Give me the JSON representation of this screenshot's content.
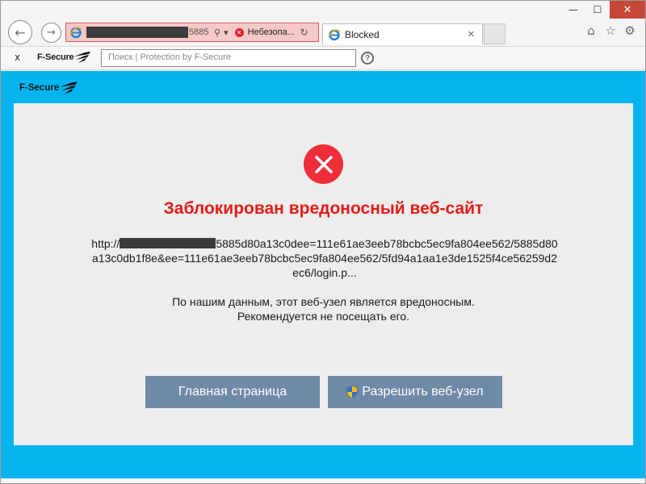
{
  "window": {
    "minimize": "—",
    "maximize": "☐",
    "close": "✕"
  },
  "navigation": {
    "back_icon": "←",
    "forward_icon": "→"
  },
  "address_bar": {
    "url_suffix": "5885",
    "search_icon": "⚲",
    "dropdown_icon": "▾",
    "error_icon": "✕",
    "warning_text": "Небезопа...",
    "refresh_icon": "↻"
  },
  "tab": {
    "title": "Blocked",
    "close": "✕"
  },
  "toolbar_icons": {
    "home": "⌂",
    "favorites": "☆",
    "settings": "⚙"
  },
  "fsecure_toolbar": {
    "close": "x",
    "logo_text": "F-Secure",
    "search_placeholder": "Поиск | Protection by F-Secure",
    "help": "?"
  },
  "page": {
    "brand": "F-Secure",
    "headline": "Заблокирован вредоносный веб-сайт",
    "url_prefix": "http://",
    "url_rest": "5885d80a13c0dee=111e61ae3eeb78bcbc5ec9fa804ee562/5885d80a13c0db1f8e&ee=111e61ae3eeb78bcbc5ec9fa804ee562/5fd94a1aa1e3de1525f4ce56259d2ec6/login.p...",
    "message_line1": "По нашим данным, этот веб-узел является вредоносным.",
    "message_line2": "Рекомендуется не посещать его.",
    "home_button": "Главная страница",
    "allow_button": "Разрешить веб-узел"
  },
  "colors": {
    "accent_blue": "#03b4ee",
    "danger_red": "#ee2f39",
    "headline_red": "#e41b17",
    "button_gray_blue": "#6f8aa6",
    "panel_gray": "#ededed"
  }
}
